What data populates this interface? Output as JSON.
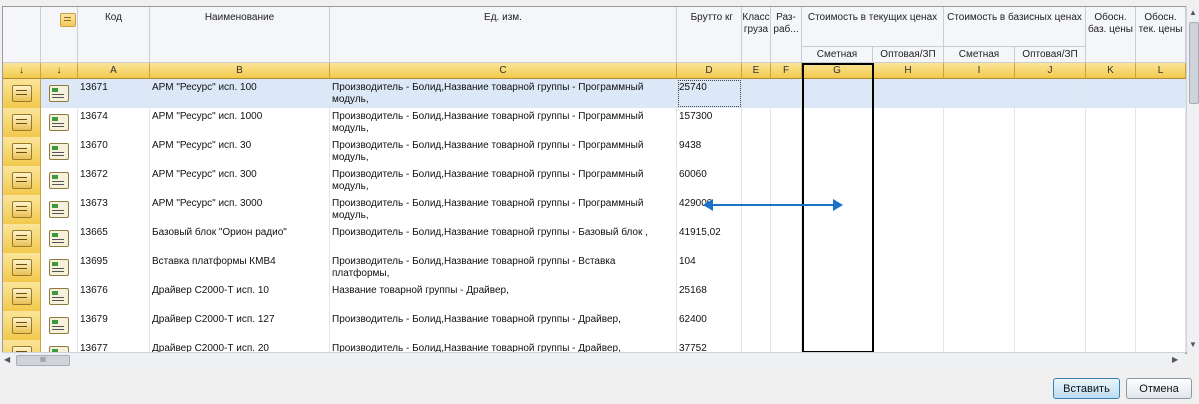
{
  "toolbar_icon": "import-sheet-icon",
  "arrow_glyph": "↓",
  "headers": {
    "kod": "Код",
    "naimenovanie": "Наименование",
    "ed_izm": "Ед. изм.",
    "brutto": "Брутто кг",
    "klass": "Класс груза",
    "razrab": "Раз-раб...",
    "stoim_tek": "Стоимость в текущих ценах",
    "stoim_baz": "Стоимость в базисных ценах",
    "smetnaya_tek": "Сметная",
    "optovaya_tek": "Оптовая/ЗП",
    "smetnaya_baz": "Сметная",
    "optovaya_baz": "Оптовая/ЗП",
    "obosn_baz": "Обосн. баз. цены",
    "obosn_tek": "Обосн. тек. цены"
  },
  "letters": [
    "A",
    "B",
    "C",
    "D",
    "E",
    "F",
    "G",
    "H",
    "I",
    "J",
    "K",
    "L"
  ],
  "rows": [
    {
      "code": "13671",
      "name": "АРМ \"Ресурс\" исп. 100",
      "unit": "Производитель - Болид,Название товарной группы - Программный модуль,",
      "weight": "25740",
      "selected": true
    },
    {
      "code": "13674",
      "name": "АРМ \"Ресурс\" исп. 1000",
      "unit": "Производитель - Болид,Название товарной группы - Программный модуль,",
      "weight": "157300"
    },
    {
      "code": "13670",
      "name": "АРМ \"Ресурс\" исп. 30",
      "unit": "Производитель - Болид,Название товарной группы - Программный модуль,",
      "weight": "9438"
    },
    {
      "code": "13672",
      "name": "АРМ \"Ресурс\" исп. 300",
      "unit": "Производитель - Болид,Название товарной группы - Программный модуль,",
      "weight": "60060"
    },
    {
      "code": "13673",
      "name": "АРМ \"Ресурс\" исп. 3000",
      "unit": "Производитель - Болид,Название товарной группы - Программный модуль,",
      "weight": "429000"
    },
    {
      "code": "13665",
      "name": "Базовый блок \"Орион радио\"",
      "unit": "Производитель - Болид,Название товарной группы - Базовый блок ,",
      "weight": "41915,02"
    },
    {
      "code": "13695",
      "name": "Вставка платформы КМВ4",
      "unit": "Производитель - Болид,Название товарной группы - Вставка платформы,",
      "weight": "104"
    },
    {
      "code": "13676",
      "name": "Драйвер С2000-Т исп. 10",
      "unit": "Название товарной группы - Драйвер,",
      "weight": "25168"
    },
    {
      "code": "13679",
      "name": "Драйвер С2000-Т исп. 127",
      "unit": "Производитель - Болид,Название товарной группы - Драйвер,",
      "weight": "62400"
    },
    {
      "code": "13677",
      "name": "Драйвер С2000-Т исп. 20",
      "unit": "Производитель - Болид,Название товарной группы - Драйвер,",
      "weight": "37752"
    }
  ],
  "scroll_grip": "III",
  "buttons": {
    "insert": "Вставить",
    "cancel": "Отмена"
  },
  "colors": {
    "letter_bar": "#f2c94c",
    "selected_row": "#dce8f7",
    "resize_arrow": "#1a73c8",
    "focus_border": "#000000"
  }
}
